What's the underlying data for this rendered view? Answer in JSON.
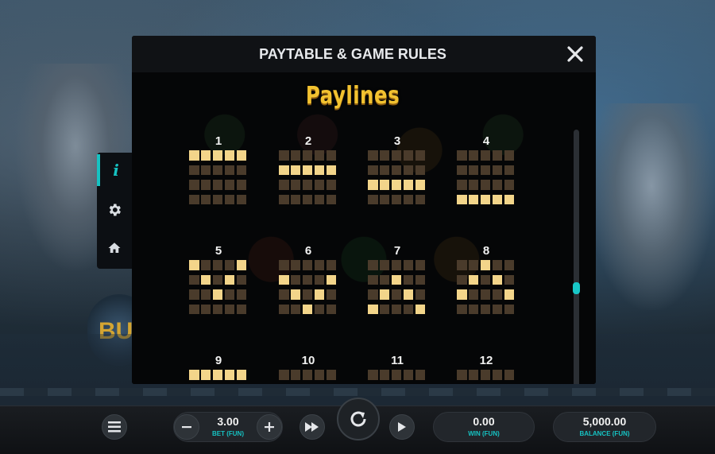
{
  "modal": {
    "title": "PAYTABLE & GAME RULES",
    "section_title": "Paylines"
  },
  "paylines": [
    {
      "number": "1",
      "rows": [
        0,
        0,
        0,
        0,
        0
      ]
    },
    {
      "number": "2",
      "rows": [
        1,
        1,
        1,
        1,
        1
      ]
    },
    {
      "number": "3",
      "rows": [
        2,
        2,
        2,
        2,
        2
      ]
    },
    {
      "number": "4",
      "rows": [
        3,
        3,
        3,
        3,
        3
      ]
    },
    {
      "number": "5",
      "rows": [
        0,
        1,
        2,
        1,
        0
      ]
    },
    {
      "number": "6",
      "rows": [
        1,
        2,
        3,
        2,
        1
      ]
    },
    {
      "number": "7",
      "rows": [
        3,
        2,
        1,
        2,
        3
      ]
    },
    {
      "number": "8",
      "rows": [
        2,
        1,
        0,
        1,
        2
      ]
    },
    {
      "number": "9",
      "rows": [
        0,
        0,
        0,
        0,
        0
      ]
    },
    {
      "number": "10",
      "rows": []
    },
    {
      "number": "11",
      "rows": []
    },
    {
      "number": "12",
      "rows": []
    }
  ],
  "side_menu": {
    "items": [
      {
        "id": "info",
        "icon": "info-icon",
        "active": true
      },
      {
        "id": "settings",
        "icon": "gear-icon",
        "active": false
      },
      {
        "id": "home",
        "icon": "home-icon",
        "active": false
      }
    ]
  },
  "background": {
    "buy_text": "BU"
  },
  "bottom_bar": {
    "bet": {
      "value": "3.00",
      "label": "BET (FUN)"
    },
    "win": {
      "value": "0.00",
      "label": "WIN (FUN)"
    },
    "balance": {
      "value": "5,000.00",
      "label": "BALANCE (FUN)"
    }
  },
  "colors": {
    "accent": "#16c2c2",
    "title_gold": "#f2c230",
    "cell_on": "#f3d58a",
    "cell_off": "#4a3b2b"
  },
  "scroll": {
    "position": 0.6
  }
}
